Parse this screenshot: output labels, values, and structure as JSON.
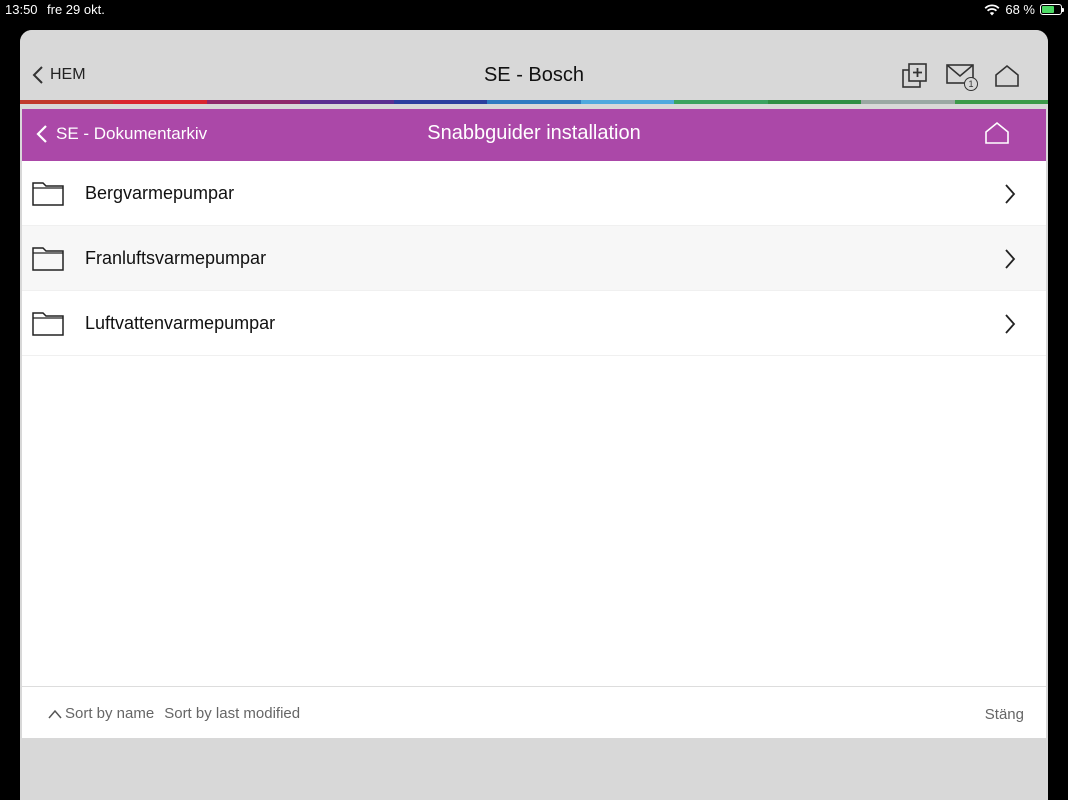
{
  "status_bar": {
    "time": "13:50",
    "date": "fre 29 okt.",
    "battery": "68 %",
    "battery_level": 0.68
  },
  "top_nav": {
    "back_label": "HEM",
    "title": "SE - Bosch",
    "mail_badge": "1",
    "icons": [
      "add-icon",
      "mail-icon",
      "home-icon"
    ]
  },
  "color_bar": [
    "#c0392b",
    "#d9262f",
    "#8e2a6b",
    "#5b2f91",
    "#2b3f9e",
    "#2e7bc1",
    "#4fa9de",
    "#3aa35f",
    "#2f8f45",
    "#9aa8a3",
    "#3c9a4a"
  ],
  "sub_nav": {
    "back_label": "SE - Dokumentarkiv",
    "title": "Snabbguider installation",
    "accent": "#ab48a8"
  },
  "list": {
    "items": [
      {
        "label": "Bergvarmepumpar"
      },
      {
        "label": "Franluftsvarmepumpar"
      },
      {
        "label": "Luftvattenvarmepumpar"
      }
    ]
  },
  "footer": {
    "sort_by_name": "Sort by name",
    "sort_by_modified": "Sort by last modified",
    "close_label": "Stäng"
  }
}
